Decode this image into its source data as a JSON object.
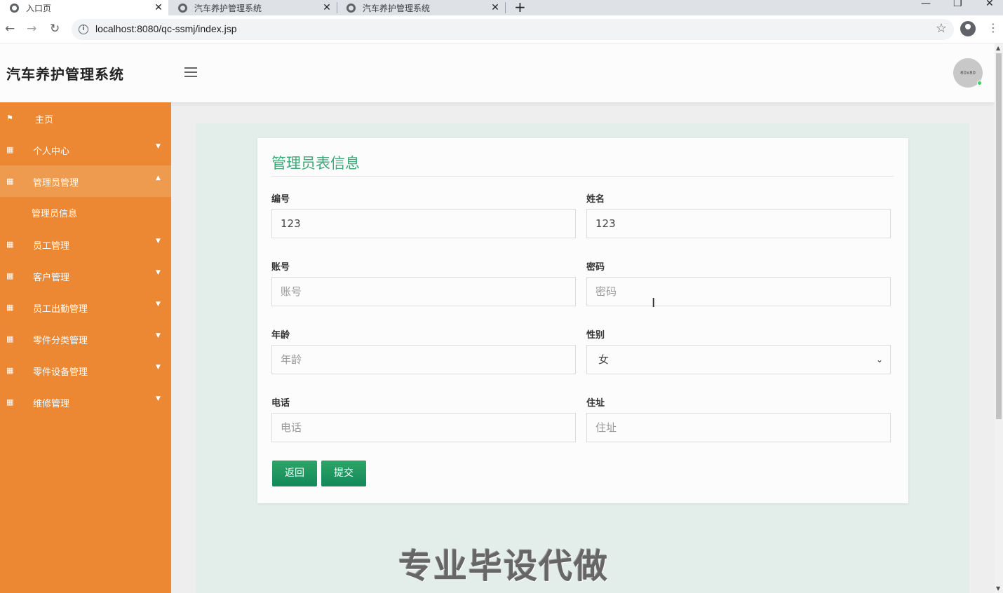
{
  "browser": {
    "tabs": [
      {
        "title": "入口页",
        "active": true
      },
      {
        "title": "汽车养护管理系统",
        "active": false
      },
      {
        "title": "汽车养护管理系统",
        "active": false
      }
    ],
    "url": "localhost:8080/qc-ssmj/index.jsp"
  },
  "header": {
    "brand": "汽车养护管理系统",
    "avatar_text": "80x80"
  },
  "sidebar": {
    "items": [
      {
        "label": "主页",
        "icon": "flag-icon",
        "has_caret": false
      },
      {
        "label": "个人中心",
        "icon": "grid-icon",
        "has_caret": true
      },
      {
        "label": "管理员管理",
        "icon": "grid-icon",
        "has_caret": true,
        "open": true
      },
      {
        "label": "管理员信息",
        "sub": true
      },
      {
        "label": "员工管理",
        "icon": "grid-icon",
        "has_caret": true
      },
      {
        "label": "客户管理",
        "icon": "grid-icon",
        "has_caret": true
      },
      {
        "label": "员工出勤管理",
        "icon": "grid-icon",
        "has_caret": true
      },
      {
        "label": "零件分类管理",
        "icon": "grid-icon",
        "has_caret": true
      },
      {
        "label": "零件设备管理",
        "icon": "grid-icon",
        "has_caret": true
      },
      {
        "label": "维修管理",
        "icon": "grid-icon",
        "has_caret": true
      }
    ]
  },
  "form": {
    "title": "管理员表信息",
    "fields": {
      "bianhao": {
        "label": "编号",
        "value": "123",
        "placeholder": ""
      },
      "xingming": {
        "label": "姓名",
        "value": "123",
        "placeholder": ""
      },
      "zhanghao": {
        "label": "账号",
        "value": "",
        "placeholder": "账号"
      },
      "mima": {
        "label": "密码",
        "value": "",
        "placeholder": "密码"
      },
      "nianling": {
        "label": "年龄",
        "value": "",
        "placeholder": "年龄"
      },
      "xingbie": {
        "label": "性别",
        "value": "女"
      },
      "dianhua": {
        "label": "电话",
        "value": "",
        "placeholder": "电话"
      },
      "zhuzhi": {
        "label": "住址",
        "value": "",
        "placeholder": "住址"
      }
    },
    "buttons": {
      "back": "返回",
      "submit": "提交"
    }
  },
  "watermark": "专业毕设代做",
  "colors": {
    "sidebar": "#ec8734",
    "accent": "#3fa97a",
    "button": "#11895a"
  }
}
